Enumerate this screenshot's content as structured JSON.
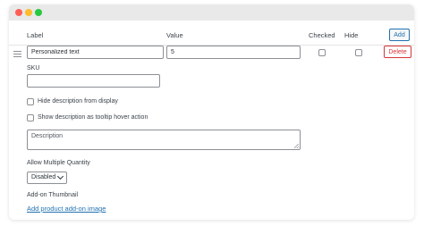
{
  "header": {
    "label_col": "Label",
    "value_col": "Value",
    "checked_col": "Checked",
    "hide_col": "Hide",
    "add_button": "Add"
  },
  "row": {
    "label_value": "Personalized text",
    "value_value": "5",
    "checked": false,
    "hidden": false,
    "delete_button": "Delete"
  },
  "sku": {
    "label": "SKU",
    "value": ""
  },
  "options": {
    "hide_description": "Hide description from display",
    "show_tooltip": "Show description as tooltip hover action"
  },
  "description": {
    "placeholder": "Description"
  },
  "quantity": {
    "label": "Allow Multiple Quantity",
    "selected": "Disabled"
  },
  "thumbnail": {
    "label": "Add-on Thumbnail",
    "link": "Add product add-on image"
  },
  "colors": {
    "accent": "#2271b1",
    "danger": "#d63638",
    "border": "#8c8f94"
  }
}
